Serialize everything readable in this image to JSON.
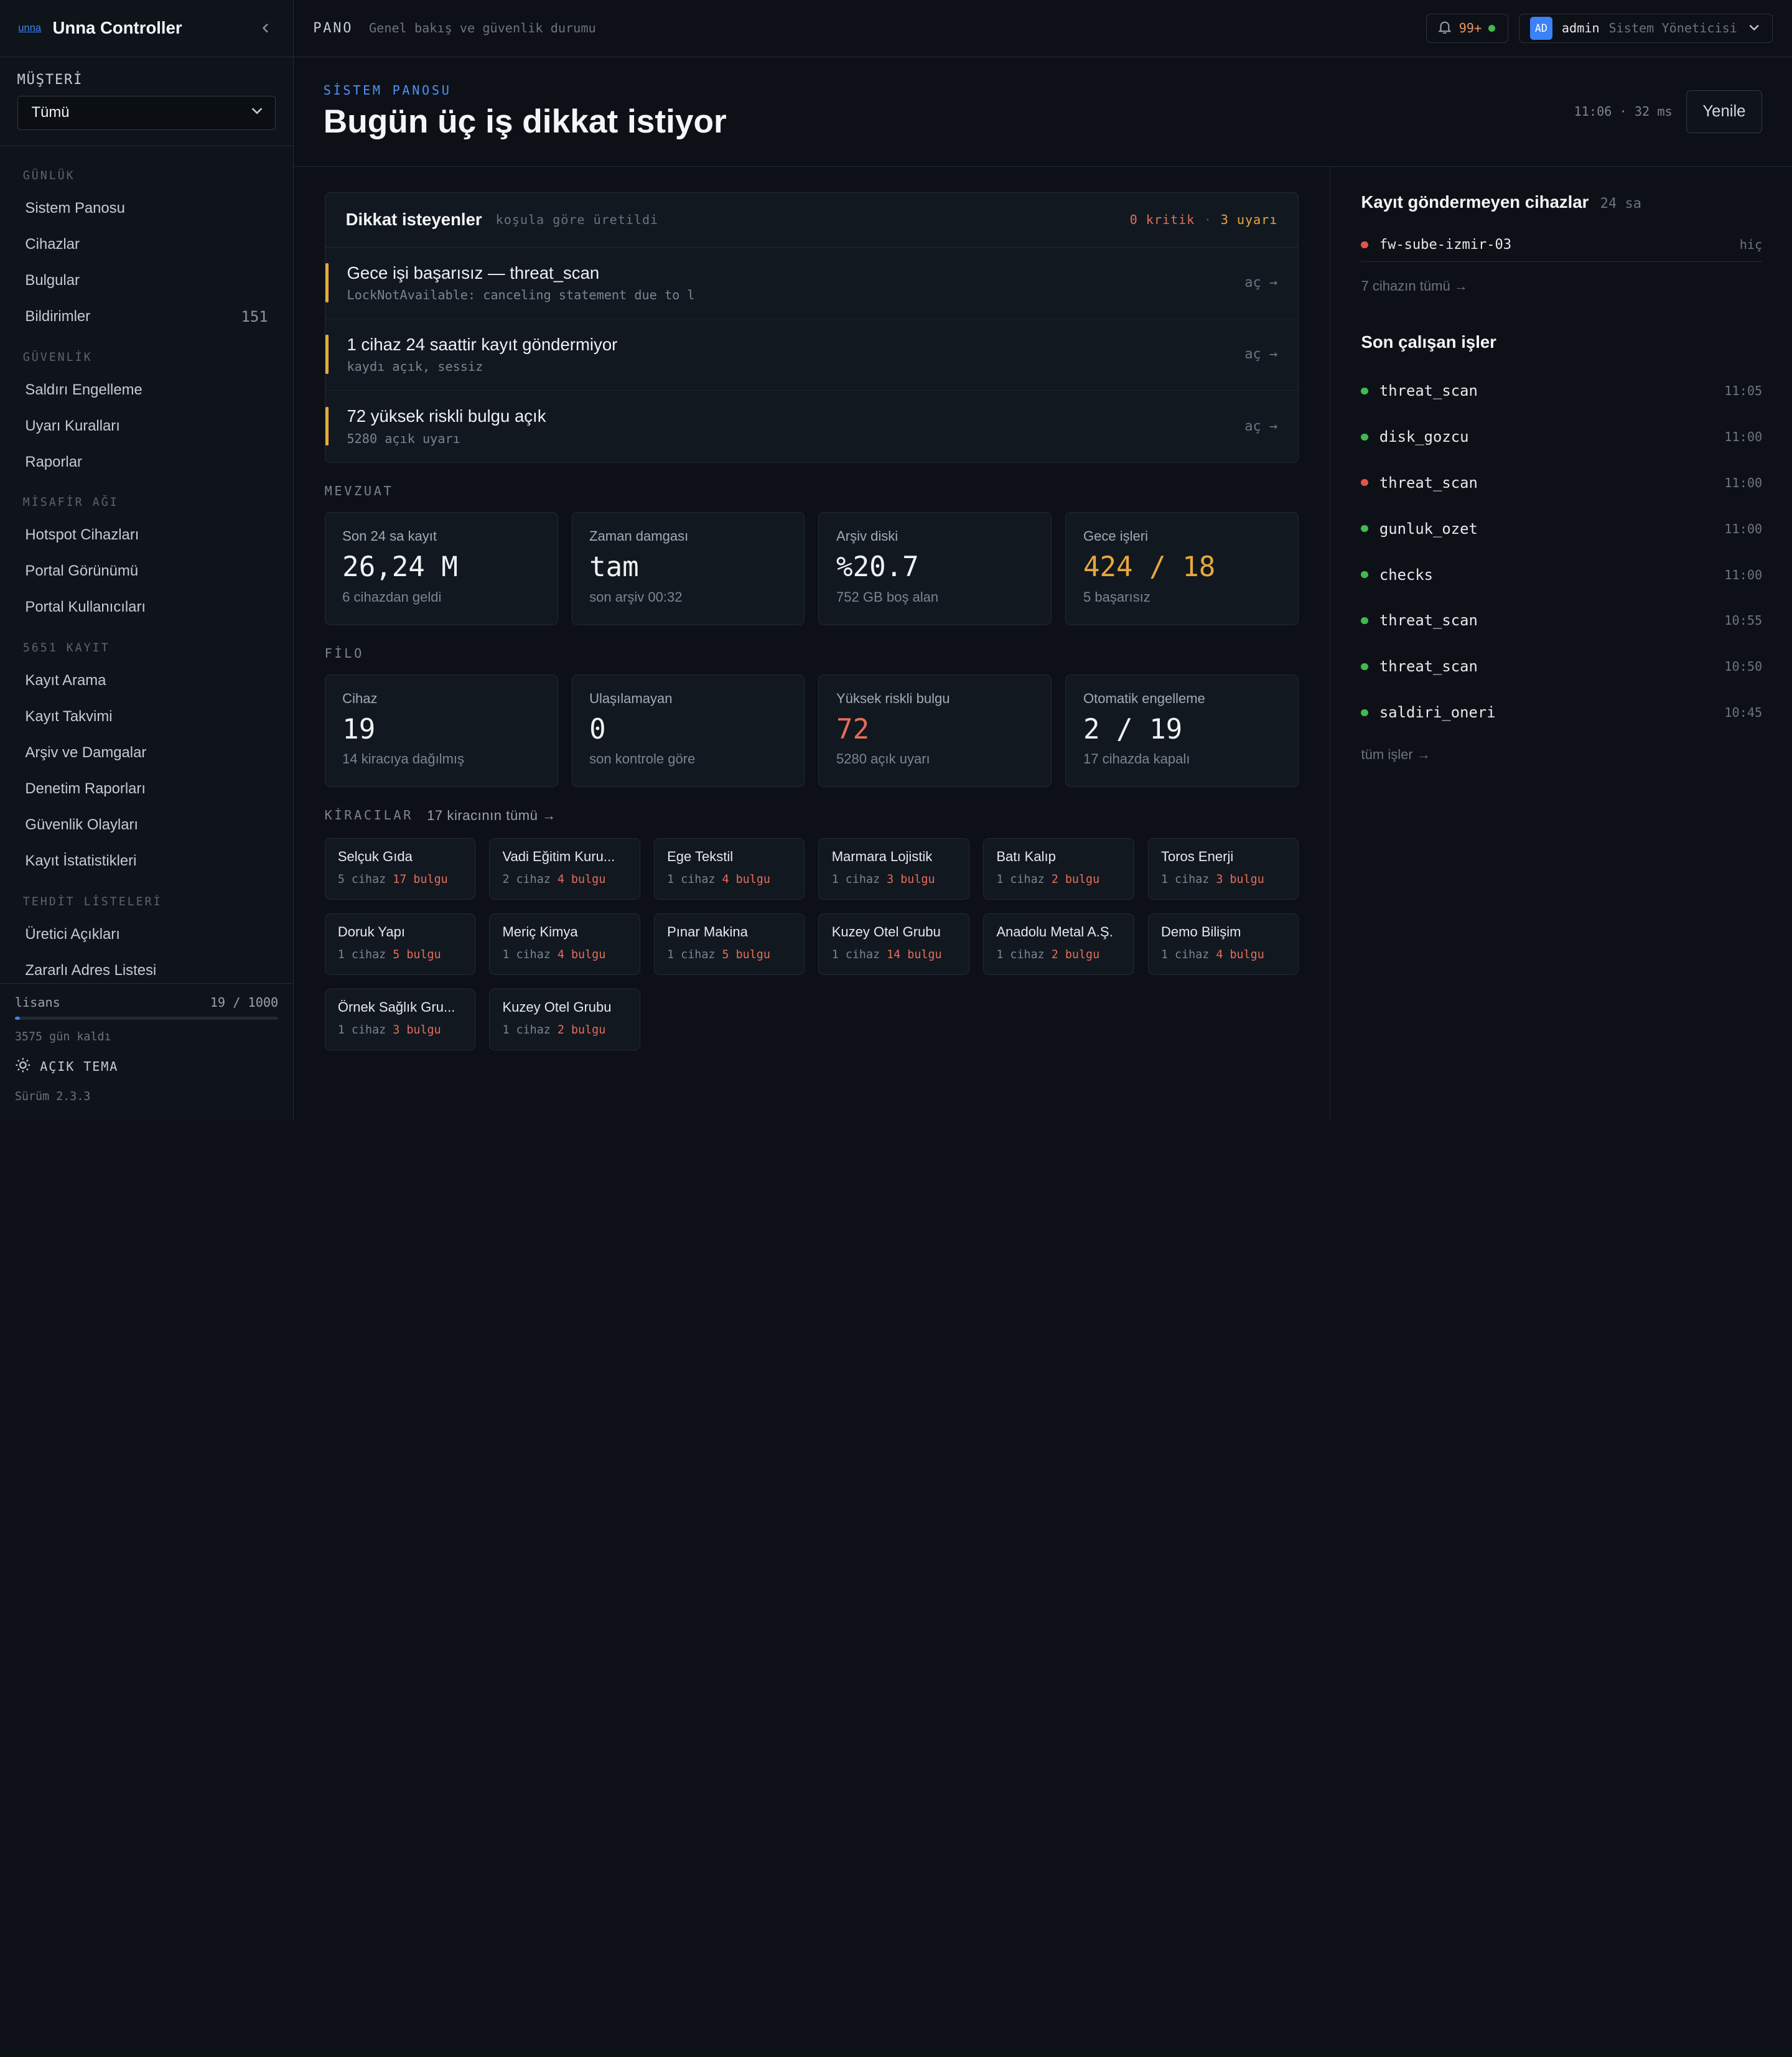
{
  "brand": {
    "logo": "unna",
    "name": "Unna Controller"
  },
  "customer": {
    "label": "MÜŞTERİ",
    "selected": "Tümü"
  },
  "nav": [
    {
      "section": "GÜNLÜK",
      "items": [
        {
          "label": "Sistem Panosu",
          "count": ""
        },
        {
          "label": "Cihazlar",
          "count": ""
        },
        {
          "label": "Bulgular",
          "count": ""
        },
        {
          "label": "Bildirimler",
          "count": "151"
        }
      ]
    },
    {
      "section": "GÜVENLİK",
      "items": [
        {
          "label": "Saldırı Engelleme",
          "count": ""
        },
        {
          "label": "Uyarı Kuralları",
          "count": ""
        },
        {
          "label": "Raporlar",
          "count": ""
        }
      ]
    },
    {
      "section": "MİSAFİR AĞI",
      "items": [
        {
          "label": "Hotspot Cihazları",
          "count": ""
        },
        {
          "label": "Portal Görünümü",
          "count": ""
        },
        {
          "label": "Portal Kullanıcıları",
          "count": ""
        }
      ]
    },
    {
      "section": "5651 KAYIT",
      "items": [
        {
          "label": "Kayıt Arama",
          "count": ""
        },
        {
          "label": "Kayıt Takvimi",
          "count": ""
        },
        {
          "label": "Arşiv ve Damgalar",
          "count": ""
        },
        {
          "label": "Denetim Raporları",
          "count": ""
        },
        {
          "label": "Güvenlik Olayları",
          "count": ""
        },
        {
          "label": "Kayıt İstatistikleri",
          "count": ""
        }
      ]
    },
    {
      "section": "TEHDİT LİSTELERİ",
      "items": [
        {
          "label": "Üretici Açıkları",
          "count": ""
        },
        {
          "label": "Zararlı Adres Listesi",
          "count": ""
        }
      ]
    }
  ],
  "license": {
    "label": "lisans",
    "used": "19 / 1000",
    "fraction": 0.019,
    "days_left": "3575 gün kaldı"
  },
  "theme_toggle": "AÇIK TEMA",
  "version": "Sürüm 2.3.3",
  "topbar": {
    "title": "PANO",
    "subtitle": "Genel bakış ve güvenlik durumu",
    "notifications": "99+",
    "user_initials": "AD",
    "user_name": "admin",
    "user_role": "Sistem Yöneticisi"
  },
  "hero": {
    "eyebrow": "SİSTEM PANOSU",
    "title": "Bugün üç iş dikkat istiyor",
    "meta": "11:06 · 32 ms",
    "refresh": "Yenile"
  },
  "attention": {
    "title": "Dikkat isteyenler",
    "subtitle": "koşula göre üretildi",
    "critical": "0 kritik",
    "sep": "·",
    "warnings": "3 uyarı",
    "open_label": "aç →",
    "items": [
      {
        "title": "Gece işi başarısız — threat_scan",
        "detail": "LockNotAvailable: canceling statement due to l"
      },
      {
        "title": "1 cihaz 24 saattir kayıt göndermiyor",
        "detail": "kaydı açık, sessiz"
      },
      {
        "title": "72 yüksek riskli bulgu açık",
        "detail": "5280 açık uyarı"
      }
    ]
  },
  "mevzuat": {
    "label": "MEVZUAT",
    "cards": [
      {
        "label": "Son 24 sa kayıt",
        "value": "26,24 M",
        "foot": "6 cihazdan geldi",
        "color": "#f0f2f4"
      },
      {
        "label": "Zaman damgası",
        "value": "tam",
        "foot": "son arşiv 00:32",
        "color": "#f0f2f4"
      },
      {
        "label": "Arşiv diski",
        "value": "%20.7",
        "foot": "752 GB boş alan",
        "color": "#f0f2f4"
      },
      {
        "label": "Gece işleri",
        "value": "424 / 18",
        "foot": "5 başarısız",
        "color": "#e6a93c"
      }
    ]
  },
  "filo": {
    "label": "FİLO",
    "cards": [
      {
        "label": "Cihaz",
        "value": "19",
        "foot": "14 kiracıya dağılmış",
        "color": "#f0f2f4"
      },
      {
        "label": "Ulaşılamayan",
        "value": "0",
        "foot": "son kontrole göre",
        "color": "#f0f2f4"
      },
      {
        "label": "Yüksek riskli bulgu",
        "value": "72",
        "foot": "5280 açık uyarı",
        "color": "#e56d5a"
      },
      {
        "label": "Otomatik engelleme",
        "value": "2 / 19",
        "foot": "17 cihazda kapalı",
        "color": "#f0f2f4"
      }
    ]
  },
  "tenants": {
    "label": "KİRACILAR",
    "link": "17 kiracının tümü →",
    "items": [
      {
        "name": "Selçuk Gıda",
        "devices": "5 cihaz",
        "findings": "17 bulgu"
      },
      {
        "name": "Vadi Eğitim Kuru...",
        "devices": "2 cihaz",
        "findings": "4 bulgu"
      },
      {
        "name": "Ege Tekstil",
        "devices": "1 cihaz",
        "findings": "4 bulgu"
      },
      {
        "name": "Marmara Lojistik",
        "devices": "1 cihaz",
        "findings": "3 bulgu"
      },
      {
        "name": "Batı Kalıp",
        "devices": "1 cihaz",
        "findings": "2 bulgu"
      },
      {
        "name": "Toros Enerji",
        "devices": "1 cihaz",
        "findings": "3 bulgu"
      },
      {
        "name": "Doruk Yapı",
        "devices": "1 cihaz",
        "findings": "5 bulgu"
      },
      {
        "name": "Meriç Kimya",
        "devices": "1 cihaz",
        "findings": "4 bulgu"
      },
      {
        "name": "Pınar Makina",
        "devices": "1 cihaz",
        "findings": "5 bulgu"
      },
      {
        "name": "Kuzey Otel Grubu",
        "devices": "1 cihaz",
        "findings": "14 bulgu"
      },
      {
        "name": "Anadolu Metal A.Ş.",
        "devices": "1 cihaz",
        "findings": "2 bulgu"
      },
      {
        "name": "Demo Bilişim",
        "devices": "1 cihaz",
        "findings": "4 bulgu"
      },
      {
        "name": "Örnek Sağlık Gru...",
        "devices": "1 cihaz",
        "findings": "3 bulgu"
      },
      {
        "name": "Kuzey Otel Grubu",
        "devices": "1 cihaz",
        "findings": "2 bulgu"
      }
    ]
  },
  "silent_devices": {
    "title": "Kayıt göndermeyen cihazlar",
    "window": "24 sa",
    "items": [
      {
        "name": "fw-sube-izmir-03",
        "last": "hiç",
        "status_color": "#e5534b"
      }
    ],
    "link": "7 cihazın tümü →"
  },
  "recent_jobs": {
    "title": "Son çalışan işler",
    "items": [
      {
        "name": "threat_scan",
        "time": "11:05",
        "status_color": "#3fb950"
      },
      {
        "name": "disk_gozcu",
        "time": "11:00",
        "status_color": "#3fb950"
      },
      {
        "name": "threat_scan",
        "time": "11:00",
        "status_color": "#e5534b"
      },
      {
        "name": "gunluk_ozet",
        "time": "11:00",
        "status_color": "#3fb950"
      },
      {
        "name": "checks",
        "time": "11:00",
        "status_color": "#3fb950"
      },
      {
        "name": "threat_scan",
        "time": "10:55",
        "status_color": "#3fb950"
      },
      {
        "name": "threat_scan",
        "time": "10:50",
        "status_color": "#3fb950"
      },
      {
        "name": "saldiri_oneri",
        "time": "10:45",
        "status_color": "#3fb950"
      }
    ],
    "link": "tüm işler →"
  },
  "colors": {
    "accent": "#3b82f6",
    "warning": "#e6a93c",
    "critical": "#e56d5a",
    "ok": "#3fb950"
  }
}
